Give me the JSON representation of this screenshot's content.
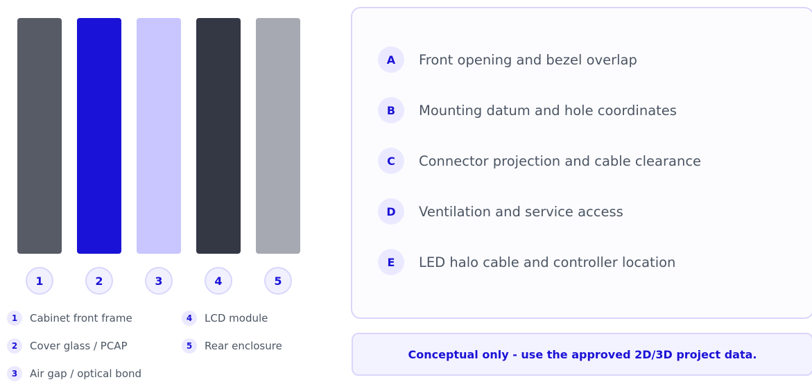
{
  "layers": [
    {
      "num": "1",
      "color": "#575b65"
    },
    {
      "num": "2",
      "color": "#1a12d6"
    },
    {
      "num": "3",
      "color": "#c8c5ff"
    },
    {
      "num": "4",
      "color": "#343845"
    },
    {
      "num": "5",
      "color": "#a6a9b2"
    }
  ],
  "legend": [
    {
      "num": "1",
      "label": "Cabinet front frame"
    },
    {
      "num": "2",
      "label": "Cover glass / PCAP"
    },
    {
      "num": "3",
      "label": "Air gap / optical bond"
    },
    {
      "num": "4",
      "label": "LCD module"
    },
    {
      "num": "5",
      "label": "Rear enclosure"
    }
  ],
  "checklist": [
    {
      "letter": "A",
      "text": "Front opening and bezel overlap"
    },
    {
      "letter": "B",
      "text": "Mounting datum and hole coordinates"
    },
    {
      "letter": "C",
      "text": "Connector projection and cable clearance"
    },
    {
      "letter": "D",
      "text": "Ventilation and service access"
    },
    {
      "letter": "E",
      "text": "LED halo cable and controller location"
    }
  ],
  "note": "Conceptual only - use the approved 2D/3D project data.",
  "colors": {
    "accent": "#1a12d6",
    "border": "#d9d6fb",
    "badge_bg": "#ebe9ff"
  }
}
